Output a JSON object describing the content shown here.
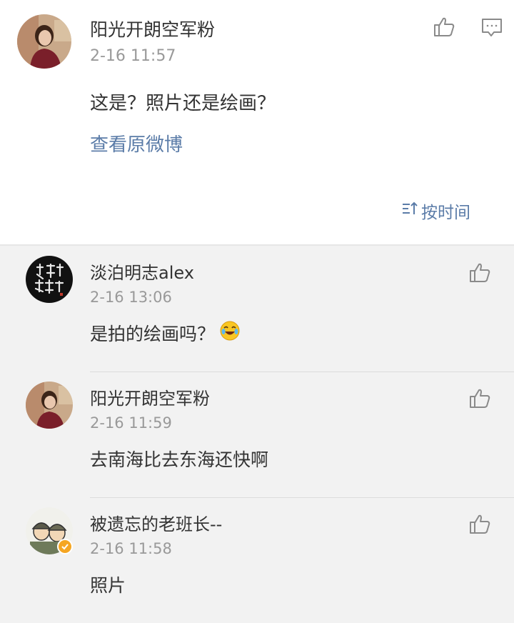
{
  "main_comment": {
    "username": "阳光开朗空军粉",
    "time": "2-16 11:57",
    "text": "这是？照片还是绘画？",
    "view_link": "查看原微博",
    "sort_label": "按时间"
  },
  "replies": [
    {
      "username": "淡泊明志alex",
      "time": "2-16 13:06",
      "text": "是拍的绘画吗？",
      "emoji": "laugh-cry"
    },
    {
      "username": "阳光开朗空军粉",
      "time": "2-16 11:59",
      "text": "去南海比去东海还快啊"
    },
    {
      "username": "被遗忘的老班长--",
      "time": "2-16 11:58",
      "text": "照片",
      "verified": true
    }
  ],
  "colors": {
    "link": "#5b7ca8",
    "muted": "#999999",
    "verified": "#f5a623"
  }
}
